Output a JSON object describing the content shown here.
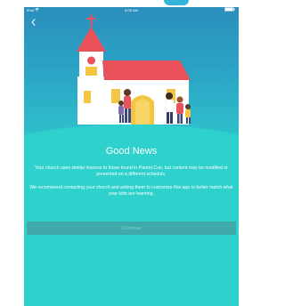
{
  "status_bar": {
    "carrier": "iPad",
    "time": "8:05 AM"
  },
  "screen": {
    "title": "Good News",
    "paragraph_1": "Your church uses similar lessons to those found in Parent Cue, but content may be modified or presented on a different schedule.",
    "paragraph_2": "We recommend contacting your church and asking them to customize this app to better match what your kids are learning.",
    "continue_label": "Continue"
  },
  "colors": {
    "background": "#2fd1cd",
    "hero_top": "#2b8ebd",
    "button": "#40a9a9",
    "button_text": "#7ad3d6",
    "church_wall": "#ffffff",
    "church_roof": "#e9525a",
    "door": "#f4c542"
  },
  "icons": [
    "back-chevron-icon",
    "wifi-icon",
    "battery-icon",
    "cross-icon"
  ]
}
